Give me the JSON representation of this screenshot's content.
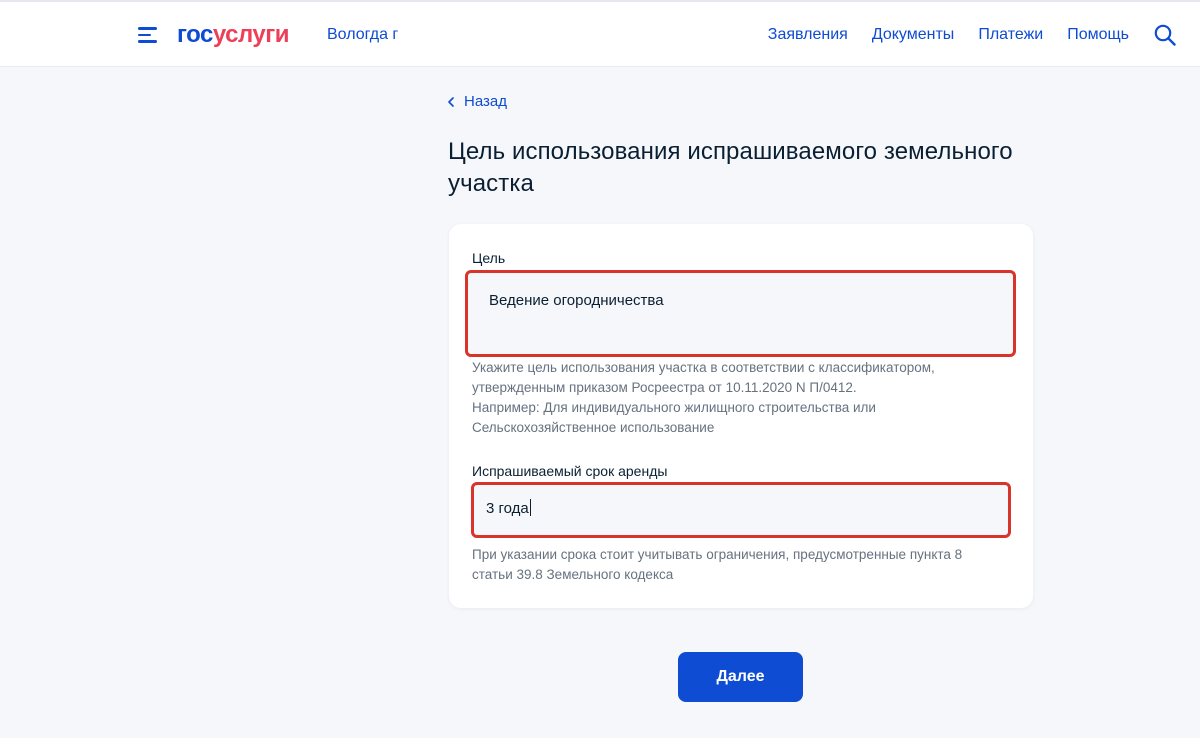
{
  "header": {
    "logo_part1": "гос",
    "logo_part2": "услуги",
    "region": "Вологда г",
    "nav": [
      "Заявления",
      "Документы",
      "Платежи",
      "Помощь"
    ]
  },
  "back_label": "Назад",
  "page_title": "Цель использования испрашиваемого земельного участка",
  "form": {
    "purpose": {
      "label": "Цель",
      "value": "Ведение огородничества",
      "hint": [
        "Укажите цель использования участка в соответствии с классификатором,",
        "утвержденным приказом Росреестра от 10.11.2020 N П/0412.",
        "Например: Для индивидуального жилищного строительства или",
        "Сельскохозяйственное использование"
      ]
    },
    "lease_term": {
      "label": "Испрашиваемый срок аренды",
      "value": "3 года",
      "hint": [
        "При указании срока стоит учитывать ограничения, предусмотренные пункта 8",
        "статьи 39.8 Земельного кодекса"
      ]
    }
  },
  "next_label": "Далее",
  "colors": {
    "accent": "#0d4cd3",
    "logo_red": "#ee3f58",
    "highlight_border": "#d9342b",
    "background": "#f5f7fb"
  },
  "icons": {
    "menu": "menu-icon",
    "search": "search-icon",
    "back": "chevron-left-icon"
  }
}
